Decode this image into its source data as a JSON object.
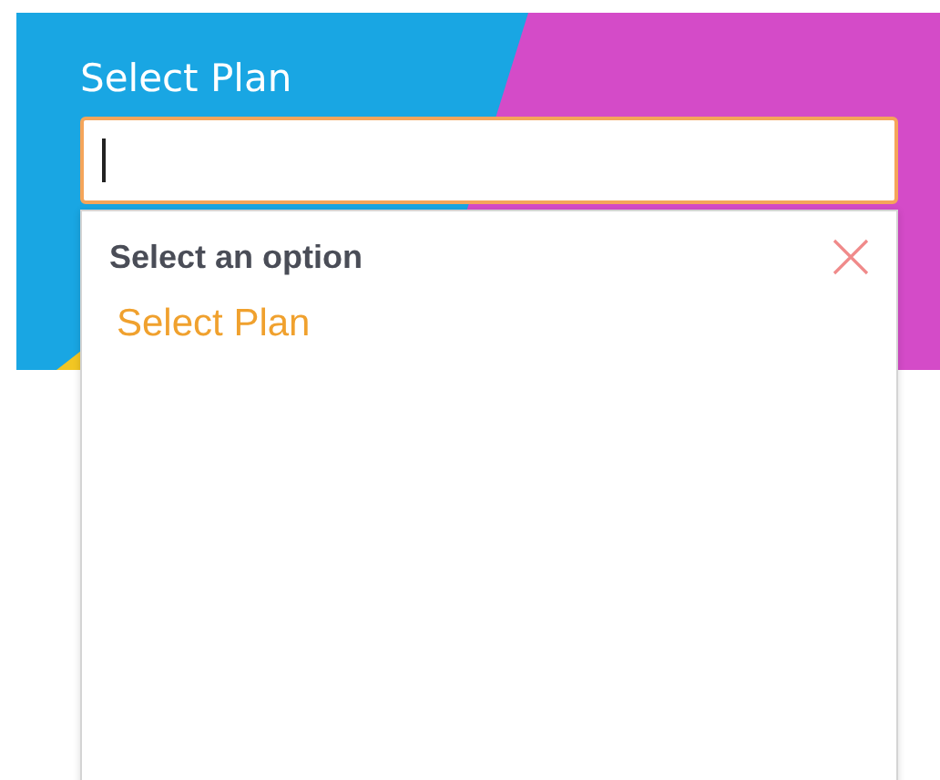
{
  "field": {
    "label": "Select Plan",
    "focused": true
  },
  "dropdown": {
    "open": true,
    "title": "Select an option",
    "options": [
      {
        "label": "Select Plan",
        "selected": true
      }
    ]
  }
}
